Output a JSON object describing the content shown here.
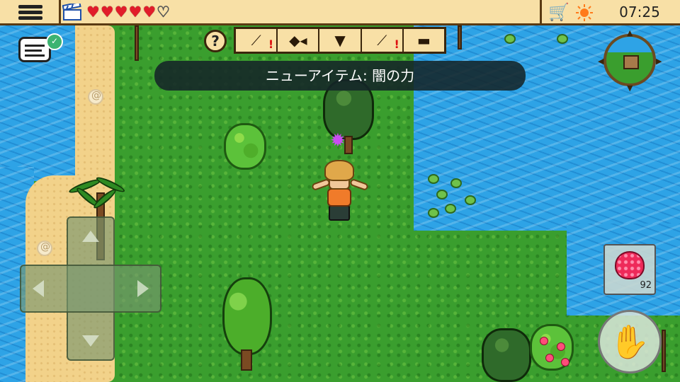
{
  "hud": {
    "hearts_full": 5,
    "hearts_total": 6,
    "clock": "07:25"
  },
  "notification": {
    "text": "ニューアイテム: 闇の力"
  },
  "help": {
    "label": "?"
  },
  "toolbar": {
    "tools": [
      {
        "name": "crafting-tools",
        "icon": "branch-icon",
        "alert": true
      },
      {
        "name": "food",
        "icon": "fish-icon",
        "alert": false
      },
      {
        "name": "clothing",
        "icon": "shirt-icon",
        "alert": false
      },
      {
        "name": "tools",
        "icon": "shovel-icon",
        "alert": true
      },
      {
        "name": "workbench",
        "icon": "anvil-icon",
        "alert": false
      }
    ],
    "alert_mark": "!"
  },
  "inventory": {
    "item": "raspberry",
    "count": "92"
  },
  "colors": {
    "water": "#2ea3e6",
    "grass": "#3a9e2e",
    "sand": "#f2d28a",
    "panel": "#f8e0a6"
  }
}
